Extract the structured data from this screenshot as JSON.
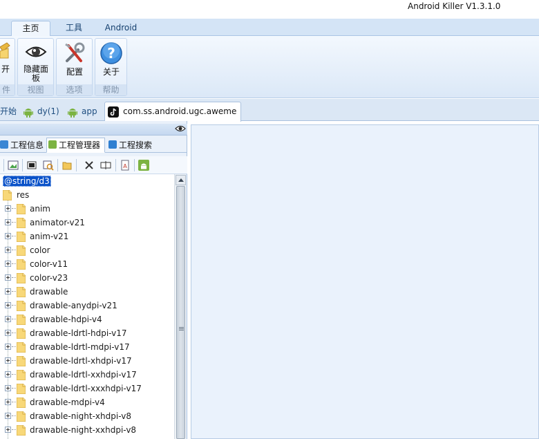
{
  "window": {
    "title": "Android Killer V1.3.1.0"
  },
  "ribbon_tabs": [
    "主页",
    "工具",
    "Android"
  ],
  "ribbon_groups": {
    "file": {
      "open_label": "开",
      "caption": "件"
    },
    "view": {
      "button_label": "隐藏面板",
      "caption": "视图"
    },
    "options": {
      "button_label": "配置",
      "caption": "选项"
    },
    "help": {
      "button_label": "关于",
      "caption": "帮助"
    }
  },
  "doc_tabs": {
    "start": "开始",
    "dy": "dy(1)",
    "app": "app",
    "project": "com.ss.android.ugc.aweme"
  },
  "project_panel": {
    "tabs": [
      "工程信息",
      "工程管理器",
      "工程搜索"
    ],
    "tree": {
      "selected": "@string/d3",
      "root": "res",
      "children": [
        "anim",
        "animator-v21",
        "anim-v21",
        "color",
        "color-v11",
        "color-v23",
        "drawable",
        "drawable-anydpi-v21",
        "drawable-hdpi-v4",
        "drawable-ldrtl-hdpi-v17",
        "drawable-ldrtl-mdpi-v17",
        "drawable-ldrtl-xhdpi-v17",
        "drawable-ldrtl-xxhdpi-v17",
        "drawable-ldrtl-xxxhdpi-v17",
        "drawable-mdpi-v4",
        "drawable-night-xhdpi-v8",
        "drawable-night-xxhdpi-v8"
      ]
    }
  },
  "colors": {
    "accent": "#0a52c9",
    "ribbon": "#d4e4f6",
    "android_green": "#7cb342",
    "folder": "#f6d26b"
  }
}
